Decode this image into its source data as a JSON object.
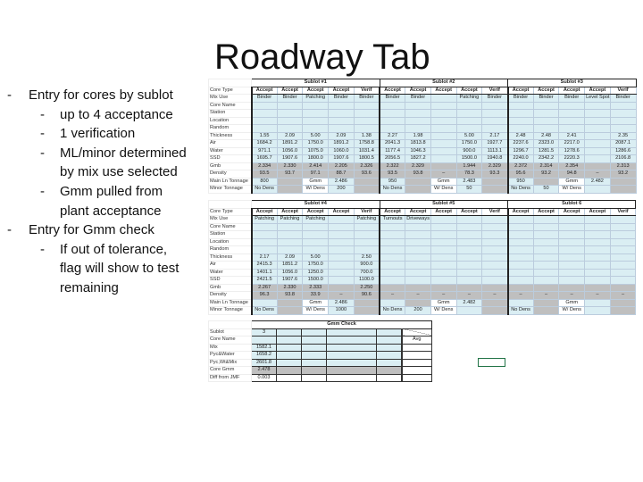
{
  "slide": {
    "title": "Roadway Tab",
    "bullets": [
      {
        "level": 1,
        "text": "Entry for cores by sublot"
      },
      {
        "level": 2,
        "text": "up to 4 acceptance"
      },
      {
        "level": 2,
        "text": "1 verification"
      },
      {
        "level": 2,
        "text": "ML/minor determined by mix use selected"
      },
      {
        "level": 2,
        "text": "Gmm pulled from plant acceptance"
      },
      {
        "level": 1,
        "text": "Entry for Gmm check"
      },
      {
        "level": 2,
        "text": "If out of tolerance, flag will show to test remaining"
      }
    ]
  },
  "row_labels": [
    "Core Type",
    "Mix Use",
    "Core Name",
    "Station",
    "Location",
    "Random",
    "Thickness",
    "Air",
    "Water",
    "SSD",
    "Gmb",
    "Density",
    "Main Ln Tonnage",
    "Minor Tonnage"
  ],
  "block1": {
    "sublots": [
      "Sublot #1",
      "Sublot #2",
      "Sublot #3"
    ],
    "rows": [
      [
        "Accept",
        "Accept",
        "Accept",
        "Accept",
        "Verif",
        "Accept",
        "Accept",
        "Accept",
        "Accept",
        "Verif",
        "Accept",
        "Accept",
        "Accept",
        "Accept",
        "Verif"
      ],
      [
        "Binder",
        "Binder",
        "Patching",
        "Binder",
        "Binder",
        "Binder",
        "Binder",
        "",
        "Patching",
        "Binder",
        "Binder",
        "Binder",
        "Binder",
        "Level Spot",
        "Binder"
      ],
      [
        "",
        "",
        "",
        "",
        "",
        "",
        "",
        "",
        "",
        "",
        "",
        "",
        "",
        "",
        ""
      ],
      [
        "",
        "",
        "",
        "",
        "",
        "",
        "",
        "",
        "",
        "",
        "",
        "",
        "",
        "",
        ""
      ],
      [
        "",
        "",
        "",
        "",
        "",
        "",
        "",
        "",
        "",
        "",
        "",
        "",
        "",
        "",
        ""
      ],
      [
        "",
        "",
        "",
        "",
        "",
        "",
        "",
        "",
        "",
        "",
        "",
        "",
        "",
        "",
        ""
      ],
      [
        "1.55",
        "2.09",
        "5.00",
        "2.09",
        "1.38",
        "2.27",
        "1.98",
        "",
        "5.00",
        "2.17",
        "2.48",
        "2.48",
        "2.41",
        "",
        "2.35"
      ],
      [
        "1684.2",
        "1891.2",
        "1750.0",
        "1891.2",
        "1758.8",
        "2041.3",
        "1813.8",
        "",
        "1750.0",
        "1927.7",
        "2237.6",
        "2323.0",
        "2217.0",
        "",
        "2087.1"
      ],
      [
        "971.1",
        "1056.0",
        "1075.0",
        "1060.0",
        "1031.4",
        "1177.4",
        "1046.3",
        "",
        "900.0",
        "1113.1",
        "1296.7",
        "1281.5",
        "1278.6",
        "",
        "1286.6"
      ],
      [
        "1695.7",
        "1907.6",
        "1800.0",
        "1907.6",
        "1800.5",
        "2056.5",
        "1827.2",
        "",
        "1500.0",
        "1940.8",
        "2240.0",
        "2342.2",
        "2220.3",
        "",
        "2106.8"
      ],
      [
        "2.334",
        "2.330",
        "2.414",
        "2.205",
        "2.326",
        "2.322",
        "2.329",
        "",
        "1.944",
        "2.329",
        "2.372",
        "2.314",
        "2.354",
        "",
        "2.313"
      ],
      [
        "93.5",
        "93.7",
        "97.1",
        "88.7",
        "93.6",
        "93.5",
        "93.8",
        "–",
        "78.3",
        "93.3",
        "95.6",
        "93.2",
        "94.8",
        "–",
        "93.2"
      ],
      [
        "800",
        "",
        "Gmm",
        "2.486",
        "",
        "950",
        "",
        "Gmm",
        "2.483",
        "",
        "950",
        "",
        "Gmm",
        "2.482",
        ""
      ],
      [
        "No Dens",
        "",
        "W/ Dens",
        "200",
        "",
        "No Dens",
        "",
        "W/ Dens",
        "50",
        "",
        "No Dens",
        "50",
        "W/ Dens",
        "",
        ""
      ]
    ]
  },
  "block2": {
    "sublots": [
      "Sublot #4",
      "Sublot #5",
      "Sublot 6"
    ],
    "rows": [
      [
        "Accept",
        "Accept",
        "Accept",
        "Accept",
        "Verif",
        "Accept",
        "Accept",
        "Accept",
        "Accept",
        "Verif",
        "Accept",
        "Accept",
        "Accept",
        "Accept",
        "Verif"
      ],
      [
        "Patching",
        "Patching",
        "Patching",
        "",
        "Patching",
        "Turnouts",
        "Driveways",
        "",
        "",
        "",
        "",
        "",
        "",
        "",
        ""
      ],
      [
        "",
        "",
        "",
        "",
        "",
        "",
        "",
        "",
        "",
        "",
        "",
        "",
        "",
        "",
        ""
      ],
      [
        "",
        "",
        "",
        "",
        "",
        "",
        "",
        "",
        "",
        "",
        "",
        "",
        "",
        "",
        ""
      ],
      [
        "",
        "",
        "",
        "",
        "",
        "",
        "",
        "",
        "",
        "",
        "",
        "",
        "",
        "",
        ""
      ],
      [
        "",
        "",
        "",
        "",
        "",
        "",
        "",
        "",
        "",
        "",
        "",
        "",
        "",
        "",
        ""
      ],
      [
        "2.17",
        "2.09",
        "5.00",
        "",
        "2.50",
        "",
        "",
        "",
        "",
        "",
        "",
        "",
        "",
        "",
        ""
      ],
      [
        "2415.3",
        "1851.2",
        "1750.0",
        "",
        "900.0",
        "",
        "",
        "",
        "",
        "",
        "",
        "",
        "",
        "",
        ""
      ],
      [
        "1401.1",
        "1056.0",
        "1250.0",
        "",
        "700.0",
        "",
        "",
        "",
        "",
        "",
        "",
        "",
        "",
        "",
        ""
      ],
      [
        "2421.5",
        "1907.6",
        "1500.0",
        "",
        "1100.0",
        "",
        "",
        "",
        "",
        "",
        "",
        "",
        "",
        "",
        ""
      ],
      [
        "2.267",
        "2.330",
        "2.333",
        "",
        "2.250",
        "",
        "",
        "",
        "",
        "",
        "",
        "",
        "",
        "",
        ""
      ],
      [
        "96.3",
        "93.8",
        "33.9",
        "–",
        "90.6",
        "–",
        "–",
        "–",
        "–",
        "–",
        "–",
        "–",
        "–",
        "–",
        "–"
      ],
      [
        "",
        "",
        "Gmm",
        "2.486",
        "",
        "",
        "",
        "Gmm",
        "2.482",
        "",
        "",
        "",
        "Gmm",
        "",
        ""
      ],
      [
        "No Dens",
        "",
        "W/ Dens",
        "1000",
        "",
        "No Dens",
        "200",
        "W/ Dens",
        "",
        "",
        "No Dens",
        "",
        "W/ Dens",
        "",
        ""
      ]
    ]
  },
  "gmm_check": {
    "title": "Gmm Check",
    "rows": [
      {
        "label": "Sublot",
        "values": [
          "3",
          "",
          "",
          "",
          "",
          ""
        ]
      },
      {
        "label": "Core Name",
        "values": [
          "",
          "",
          "",
          "",
          "",
          "Avg"
        ]
      },
      {
        "label": "Mix",
        "values": [
          "1582.1",
          "",
          "",
          "",
          "",
          ""
        ]
      },
      {
        "label": "Pyc&Water",
        "values": [
          "1658.2",
          "",
          "",
          "",
          "",
          ""
        ]
      },
      {
        "label": "Pyc,Wt&Mix",
        "values": [
          "2601.8",
          "",
          "",
          "",
          "",
          ""
        ]
      },
      {
        "label": "Core Gmm",
        "values": [
          "2.478",
          "",
          "",
          "",
          "",
          ""
        ]
      },
      {
        "label": "Diff from JMF",
        "values": [
          "0.003",
          "",
          "",
          "",
          "",
          ""
        ]
      }
    ]
  },
  "colors": {
    "input_cell": "#daeef3",
    "calc_cell": "#bfbfbf",
    "selection": "#217346"
  }
}
